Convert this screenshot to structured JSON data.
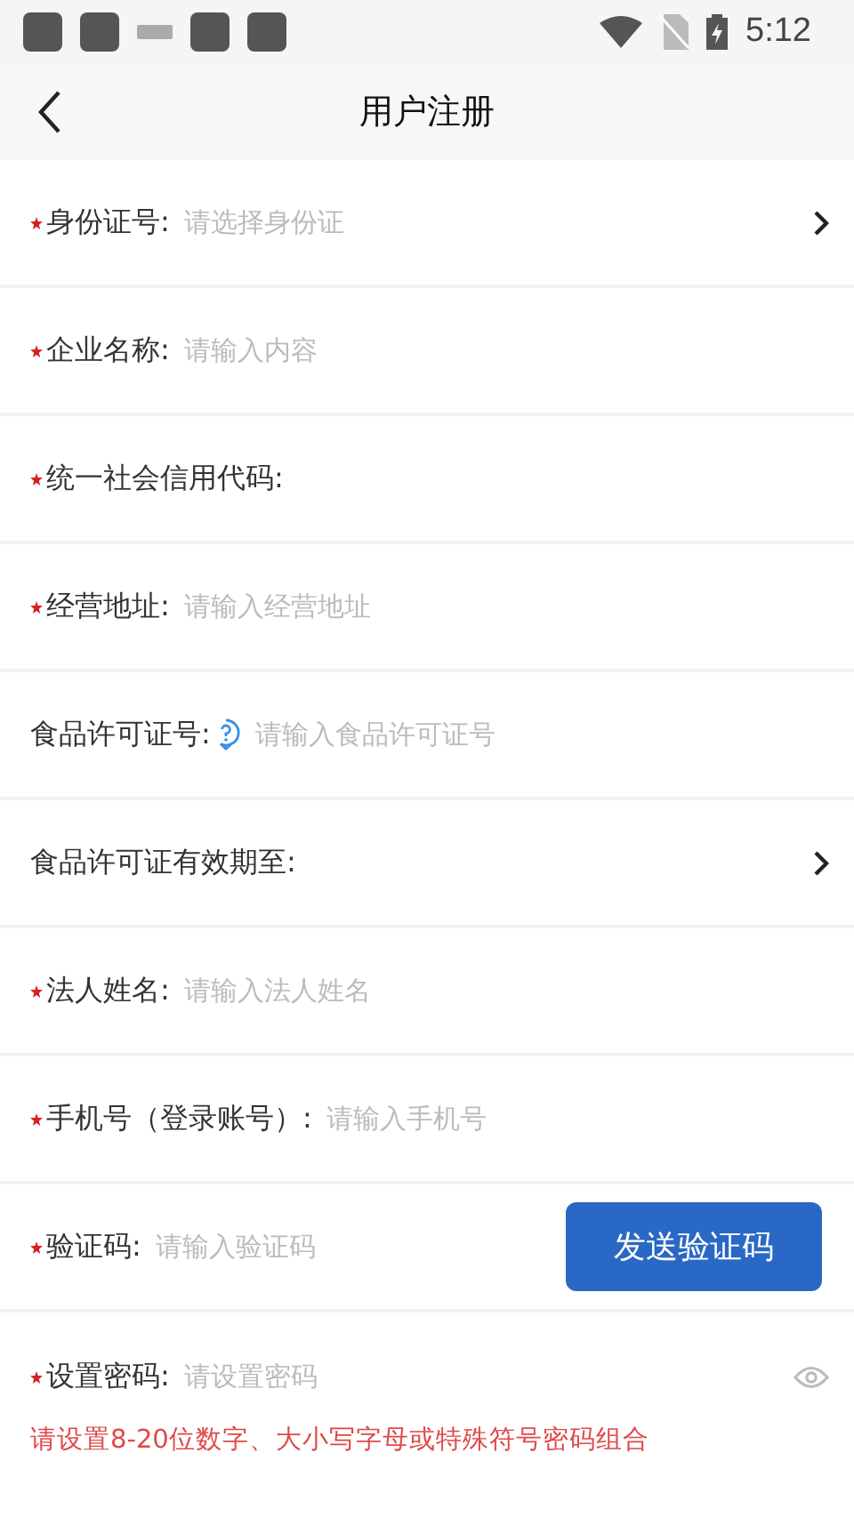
{
  "status_bar": {
    "time": "5:12"
  },
  "header": {
    "title": "用户注册"
  },
  "fields": [
    {
      "kind": "select",
      "label": "身份证号:",
      "placeholder": "请选择身份证",
      "required": true,
      "help": false
    },
    {
      "kind": "input",
      "label": "企业名称:",
      "placeholder": "请输入内容",
      "required": true,
      "help": false
    },
    {
      "kind": "label",
      "label": "统一社会信用代码:",
      "required": true,
      "help": false
    },
    {
      "kind": "input",
      "label": "经营地址:",
      "placeholder": "请输入经营地址",
      "required": true,
      "help": false
    },
    {
      "kind": "input",
      "label": "食品许可证号:",
      "placeholder": "请输入食品许可证号",
      "required": false,
      "help": true
    },
    {
      "kind": "select",
      "label": "食品许可证有效期至:",
      "required": false,
      "help": false
    },
    {
      "kind": "input",
      "label": "法人姓名:",
      "placeholder": "请输入法人姓名",
      "required": true,
      "help": false
    },
    {
      "kind": "input",
      "label": "手机号（登录账号）:",
      "placeholder": "请输入手机号",
      "required": true,
      "help": false
    },
    {
      "kind": "code",
      "label": "验证码:",
      "placeholder": "请输入验证码",
      "button": "发送验证码",
      "required": true,
      "help": false
    },
    {
      "kind": "password",
      "label": "设置密码:",
      "placeholder": "请设置密码",
      "hint": "请设置8-20位数字、大小写字母或特殊符号密码组合",
      "required": true,
      "help": false
    }
  ]
}
